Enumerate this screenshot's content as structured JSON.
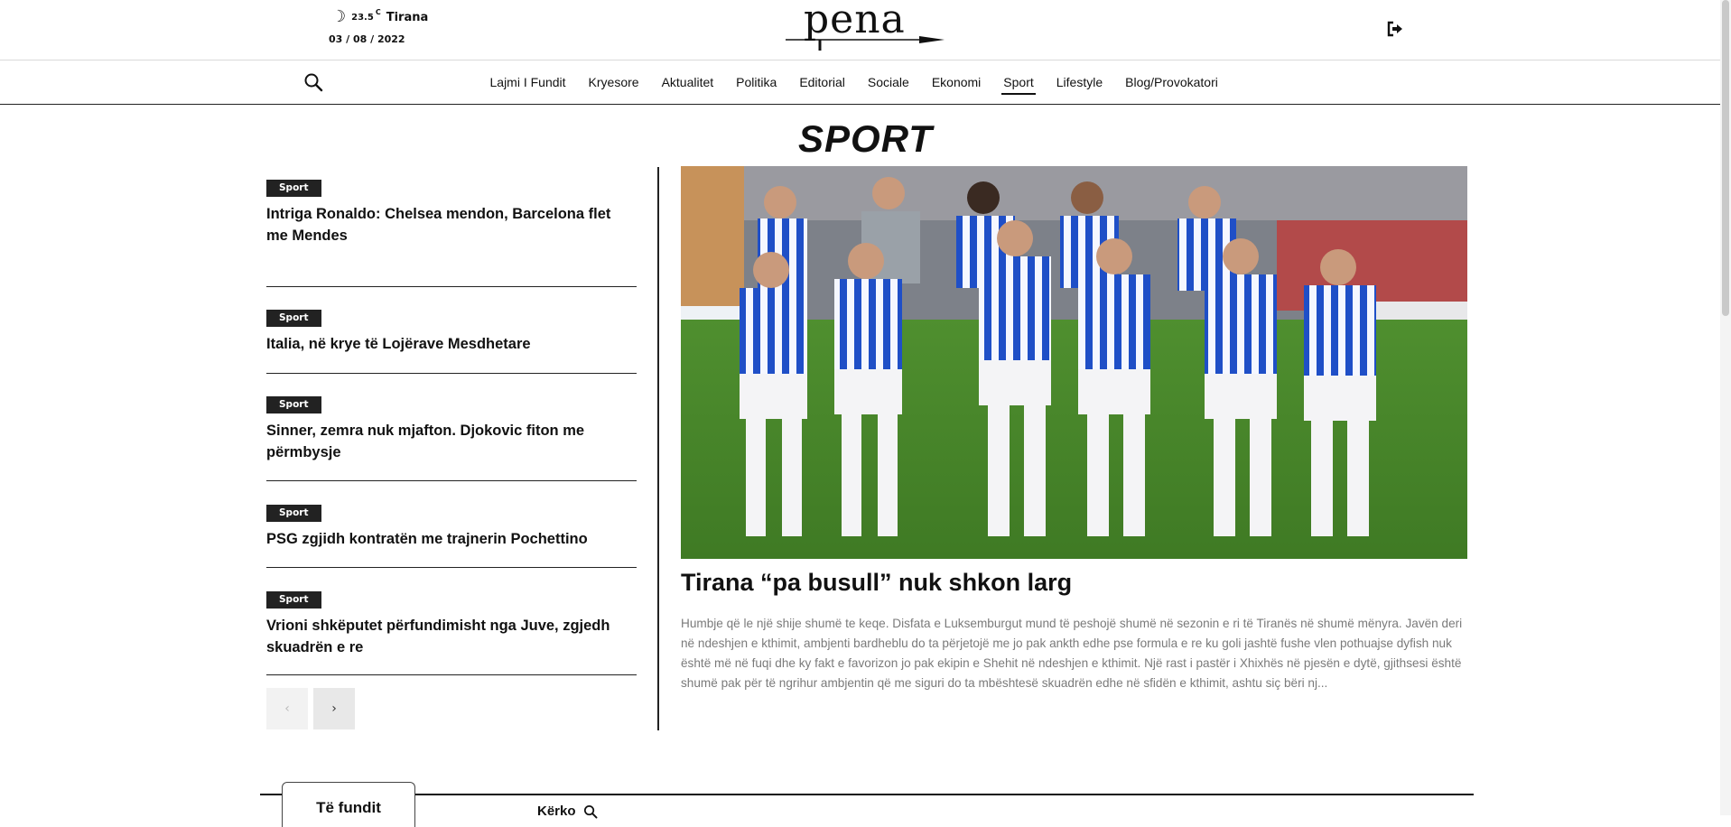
{
  "header": {
    "weather": {
      "icon": "moon-icon",
      "temp": "23.5",
      "unit": "C",
      "city": "Tirana"
    },
    "date": "03 / 08 / 2022",
    "logo_text": "pena",
    "signout_icon": "signout-icon"
  },
  "nav": {
    "search_icon": "search-icon",
    "items": [
      {
        "label": "Lajmi I Fundit"
      },
      {
        "label": "Kryesore"
      },
      {
        "label": "Aktualitet"
      },
      {
        "label": "Politika"
      },
      {
        "label": "Editorial"
      },
      {
        "label": "Sociale"
      },
      {
        "label": "Ekonomi"
      },
      {
        "label": "Sport",
        "active": true
      },
      {
        "label": "Lifestyle"
      },
      {
        "label": "Blog/Provokatori"
      }
    ]
  },
  "section": {
    "title": "SPORT"
  },
  "articles": [
    {
      "tag": "Sport",
      "title": "Intriga Ronaldo: Chelsea mendon, Barcelona flet me Mendes"
    },
    {
      "tag": "Sport",
      "title": "Italia, në krye të Lojërave Mesdhetare"
    },
    {
      "tag": "Sport",
      "title": "Sinner, zemra nuk mjafton. Djokovic fiton me përmbysje"
    },
    {
      "tag": "Sport",
      "title": "PSG zgjidh kontratën me trajnerin Pochettino"
    },
    {
      "tag": "Sport",
      "title": "Vrioni shkëputet përfundimisht nga Juve, zgjedh skuadrën e re"
    }
  ],
  "pager": {
    "prev": "‹",
    "next": "›"
  },
  "featured": {
    "title": "Tirana “pa busull” nuk shkon larg",
    "excerpt": "Humbje që le një shije shumë te keqe. Disfata e Luksemburgut mund të peshojë shumë në sezonin e ri të Tiranës në shumë mënyra. Javën deri në ndeshjen e kthimit, ambjenti bardheblu do ta përjetojë me jo pak ankth edhe pse formula e re ku goli jashtë fushe vlen pothuajse dyfish nuk është më në fuqi dhe ky fakt e favorizon jo pak ekipin e Shehit në ndeshjen e kthimit. Një rast i pastër i Xhixhës në pjesën e dytë, gjithsesi është shumë pak për të ngrihur ambjentin që me siguri do ta mbështesë skuadrën edhe në sfidën e kthimit, ashtu siç bëri nj..."
  },
  "bottom": {
    "latest_tab": "Të fundit",
    "search_label": "Kërko",
    "search_icon": "search-icon"
  }
}
